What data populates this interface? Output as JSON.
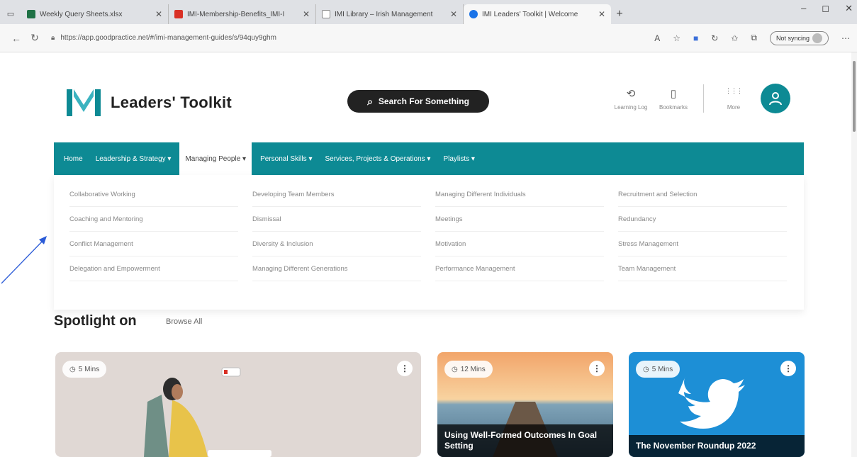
{
  "browser": {
    "tabs": [
      {
        "label": "Weekly Query Sheets.xlsx",
        "fav_color": "#1e7145"
      },
      {
        "label": "IMI-Membership-Benefits_IMI-I",
        "fav_color": "#d93025"
      },
      {
        "label": "IMI Library – Irish Management",
        "fav_color": "#888888"
      },
      {
        "label": "IMI Leaders' Toolkit | Welcome",
        "fav_color": "#1a73e8"
      }
    ],
    "new_tab": "+",
    "url": "https://app.goodpractice.net/#/imi-management-guides/s/94quy9ghm",
    "sync_label": "Not syncing",
    "controls": {
      "minimize": "–",
      "maximize": "◻",
      "close": "✕"
    }
  },
  "site": {
    "brand_name": "Leaders' Toolkit",
    "search_label": "Search For Something",
    "header_items": [
      {
        "label": "Learning Log",
        "icon": "history-icon",
        "glyph": "⟲"
      },
      {
        "label": "Bookmarks",
        "icon": "bookmark-icon",
        "glyph": "▯"
      },
      {
        "label": "More",
        "icon": "grid-icon",
        "glyph": "⋮⋮⋮"
      }
    ],
    "accent_color": "#0d8a94"
  },
  "menu": {
    "items": [
      {
        "label": "Home"
      },
      {
        "label": "Leadership & Strategy ▾"
      },
      {
        "label": "Managing People ▾",
        "active": true
      },
      {
        "label": "Personal Skills ▾"
      },
      {
        "label": "Services, Projects & Operations ▾"
      },
      {
        "label": "Playlists ▾"
      }
    ]
  },
  "dropdown": {
    "columns": [
      [
        "Collaborative Working",
        "Coaching and Mentoring",
        "Conflict Management",
        "Delegation and Empowerment"
      ],
      [
        "Developing Team Members",
        "Dismissal",
        "Diversity & Inclusion",
        "Managing Different Generations"
      ],
      [
        "Managing Different Individuals",
        "Meetings",
        "Motivation",
        "Performance Management"
      ],
      [
        "Recruitment and Selection",
        "Redundancy",
        "Stress Management",
        "Team Management"
      ]
    ]
  },
  "spotlight": {
    "title": "Spotlight on",
    "browse_all": "Browse All",
    "cards": [
      {
        "duration": "5 Mins",
        "title": ""
      },
      {
        "duration": "12 Mins",
        "title": "Using Well-Formed Outcomes In Goal Setting"
      },
      {
        "duration": "5 Mins",
        "title": "The November Roundup 2022"
      }
    ]
  }
}
